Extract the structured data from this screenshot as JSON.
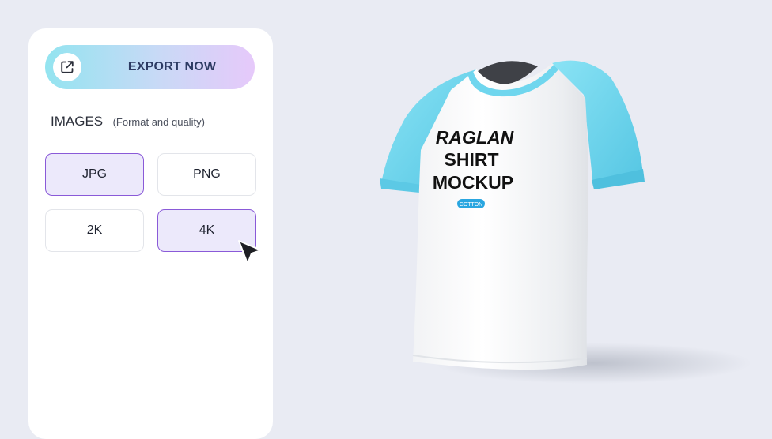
{
  "export": {
    "label": "EXPORT NOW",
    "icon": "external-link-icon"
  },
  "images_section": {
    "title": "IMAGES",
    "subtitle": "(Format and quality)"
  },
  "format_options": [
    {
      "label": "JPG",
      "selected": true
    },
    {
      "label": "PNG",
      "selected": false
    }
  ],
  "quality_options": [
    {
      "label": "2K",
      "selected": false
    },
    {
      "label": "4K",
      "selected": true
    }
  ],
  "mockup": {
    "line1": "RAGLAN",
    "line2": "SHIRT",
    "line3": "MOCKUP",
    "badge": "COTTON",
    "colors": {
      "sleeve": "#6fd6ee",
      "body": "#fbfbfb",
      "badge": "#29a6e0"
    }
  },
  "colors": {
    "background": "#e9ebf3",
    "accent": "#8a5ad8",
    "selected_fill": "#ece9fb"
  }
}
